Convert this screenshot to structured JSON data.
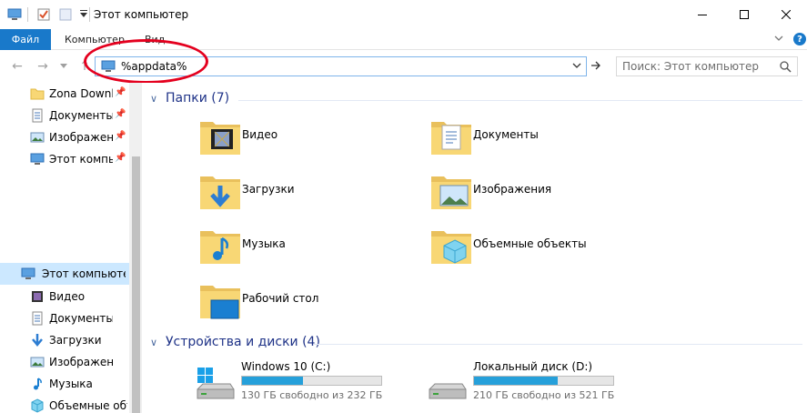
{
  "window": {
    "title": "Этот компьютер"
  },
  "ribbon": {
    "file_tab": "Файл",
    "tabs": [
      "Компьютер",
      "Вид"
    ],
    "help": "?"
  },
  "address": {
    "value": "%appdata%"
  },
  "search": {
    "placeholder": "Поиск: Этот компьютер"
  },
  "nav": {
    "quick_access": [
      {
        "label": "Zona Downlo",
        "icon": "folder-icon",
        "pinned": true
      },
      {
        "label": "Документы",
        "icon": "documents-icon",
        "pinned": true
      },
      {
        "label": "Изображени",
        "icon": "pictures-icon",
        "pinned": true
      },
      {
        "label": "Этот компью",
        "icon": "computer-icon",
        "pinned": true
      }
    ],
    "this_pc": {
      "label": "Этот компьютер",
      "icon": "computer-icon"
    },
    "children": [
      {
        "label": "Видео",
        "icon": "video-icon"
      },
      {
        "label": "Документы",
        "icon": "documents-icon"
      },
      {
        "label": "Загрузки",
        "icon": "downloads-icon"
      },
      {
        "label": "Изображения",
        "icon": "pictures-icon"
      },
      {
        "label": "Музыка",
        "icon": "music-icon"
      },
      {
        "label": "Объемные объ",
        "icon": "3d-objects-icon"
      }
    ]
  },
  "folders": {
    "header": "Папки (7)",
    "items": [
      {
        "label": "Видео",
        "icon": "video-folder-icon"
      },
      {
        "label": "Документы",
        "icon": "documents-folder-icon"
      },
      {
        "label": "Загрузки",
        "icon": "downloads-folder-icon"
      },
      {
        "label": "Изображения",
        "icon": "pictures-folder-icon"
      },
      {
        "label": "Музыка",
        "icon": "music-folder-icon"
      },
      {
        "label": "Объемные объекты",
        "icon": "3d-objects-folder-icon"
      },
      {
        "label": "Рабочий стол",
        "icon": "desktop-folder-icon"
      }
    ]
  },
  "drives": {
    "header": "Устройства и диски (4)",
    "items": [
      {
        "label": "Windows 10 (C:)",
        "free": "130 ГБ свободно из 232 ГБ",
        "used_fraction": 0.44
      },
      {
        "label": "Локальный диск (D:)",
        "free": "210 ГБ свободно из 521 ГБ",
        "used_fraction": 0.6
      }
    ]
  },
  "colors": {
    "accent": "#1979ca",
    "selection": "#cce8ff",
    "folder": "#f8d775",
    "drive_bar": "#26a0da",
    "annotation": "#e4001e"
  }
}
